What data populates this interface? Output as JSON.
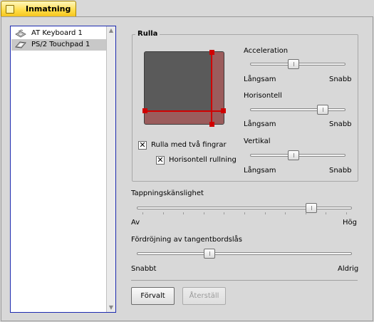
{
  "tab": {
    "label": "Inmatning"
  },
  "devices": [
    {
      "label": "AT Keyboard 1",
      "icon": "keyboard-icon",
      "selected": false
    },
    {
      "label": "PS/2 Touchpad 1",
      "icon": "touchpad-icon",
      "selected": true
    }
  ],
  "scroll_group": {
    "title": "Rulla",
    "two_finger": {
      "label": "Rulla med två fingrar",
      "checked": true
    },
    "horizontal_scroll": {
      "label": "Horisontell rullning",
      "checked": true
    },
    "acceleration": {
      "label": "Acceleration",
      "min_label": "Långsam",
      "max_label": "Snabb",
      "value": 0.45
    },
    "horizontal": {
      "label": "Horisontell",
      "min_label": "Långsam",
      "max_label": "Snabb",
      "value": 0.8
    },
    "vertical": {
      "label": "Vertikal",
      "min_label": "Långsam",
      "max_label": "Snabb",
      "value": 0.45
    }
  },
  "tap_sensitivity": {
    "label": "Tappningskänslighet",
    "min_label": "Av",
    "max_label": "Hög",
    "value": 0.83
  },
  "keyboard_delay": {
    "label": "Fördröjning av tangentbordslås",
    "min_label": "Snabbt",
    "max_label": "Aldrig",
    "value": 0.33
  },
  "buttons": {
    "default_label": "Förvalt",
    "reset_label": "Återställ"
  }
}
